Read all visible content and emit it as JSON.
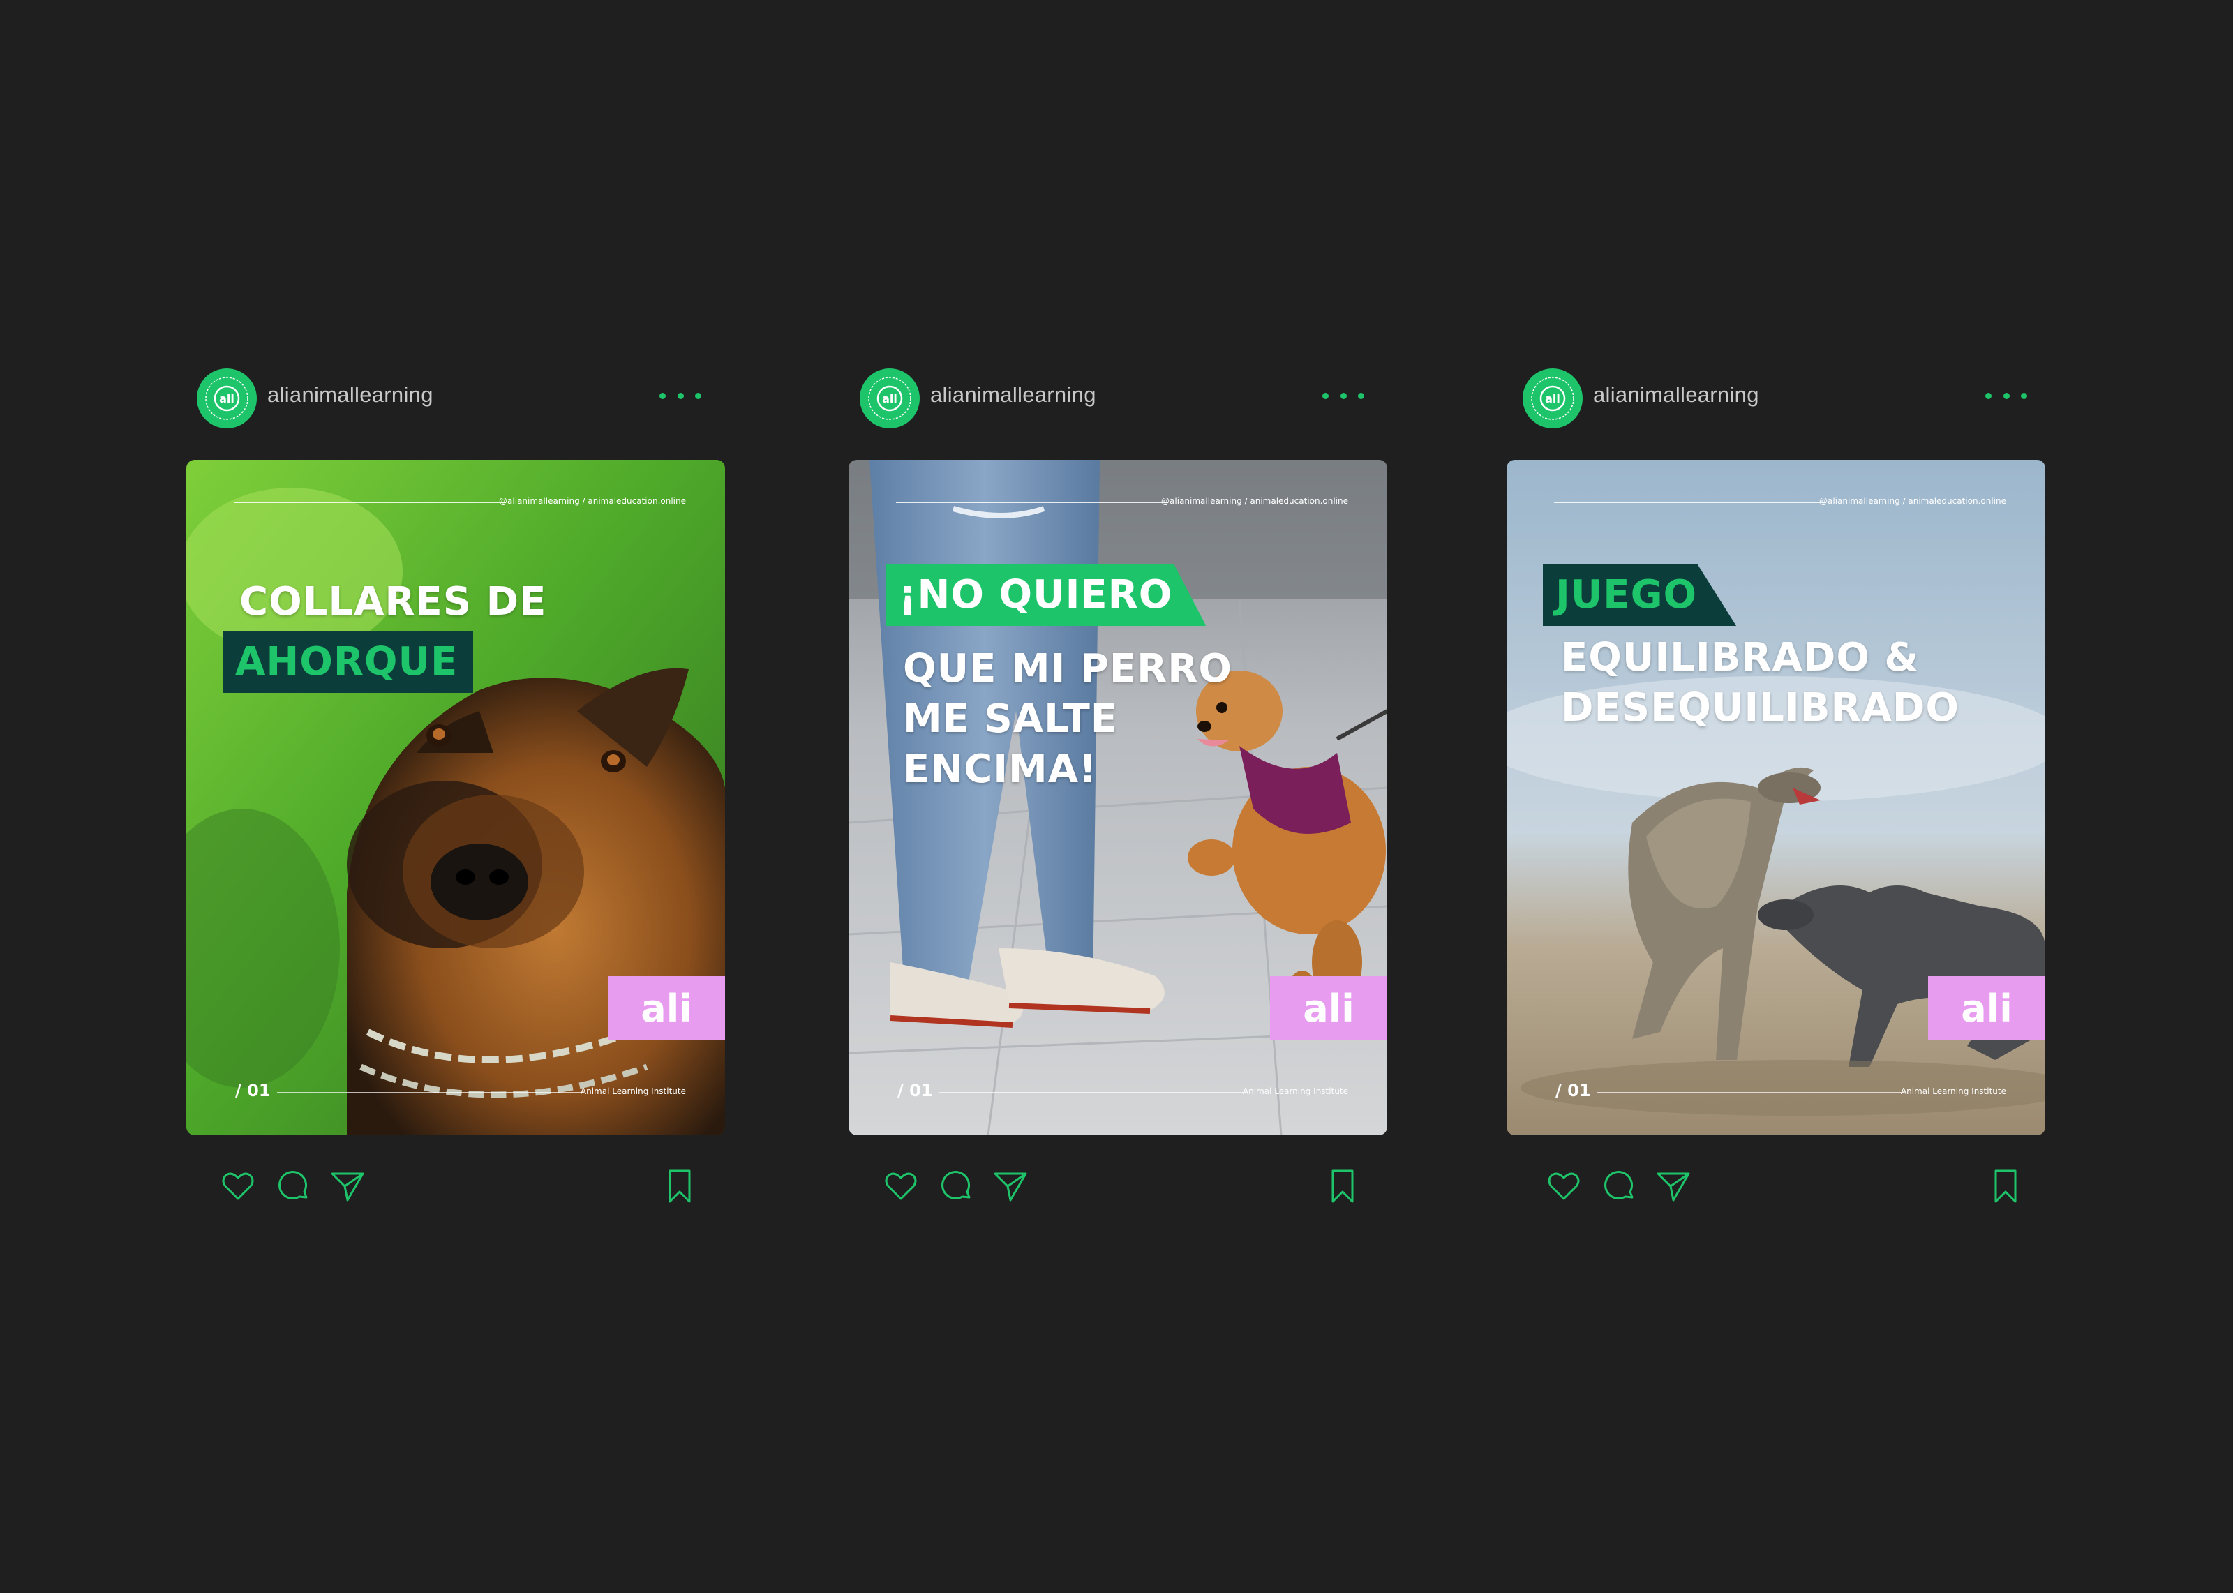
{
  "colors": {
    "background": "#1f1f1f",
    "accent_green": "#1ec46a",
    "badge_pink": "#e79cf0",
    "dark_teal": "#0b3d3a"
  },
  "icons": {
    "avatar": "ali-logo-circle",
    "more": "three-dots-icon",
    "like": "heart-icon",
    "comment": "comment-bubble-icon",
    "share": "paper-plane-icon",
    "save": "bookmark-icon"
  },
  "posts": [
    {
      "username": "alianimallearning",
      "avatar_text": "ali",
      "card": {
        "handle": "@alianimallearning / animaleducation.online",
        "headline_line1": "COLLARES DE",
        "headline_highlight": "AHORQUE",
        "badge": "ali",
        "slide_num": "/ 01",
        "institute": "Animal Learning Institute"
      }
    },
    {
      "username": "alianimallearning",
      "avatar_text": "ali",
      "card": {
        "handle": "@alianimallearning / animaleducation.online",
        "headline_highlight": "¡NO QUIERO",
        "headline_line2": "QUE MI PERRO",
        "headline_line3": "ME SALTE",
        "headline_line4": "ENCIMA!",
        "badge": "ali",
        "slide_num": "/ 01",
        "institute": "Animal Learning Institute"
      }
    },
    {
      "username": "alianimallearning",
      "avatar_text": "ali",
      "card": {
        "handle": "@alianimallearning / animaleducation.online",
        "headline_highlight": "JUEGO",
        "headline_line2": "EQUILIBRADO &",
        "headline_line3": "DESEQUILIBRADO",
        "badge": "ali",
        "slide_num": "/ 01",
        "institute": "Animal Learning Institute"
      }
    }
  ]
}
